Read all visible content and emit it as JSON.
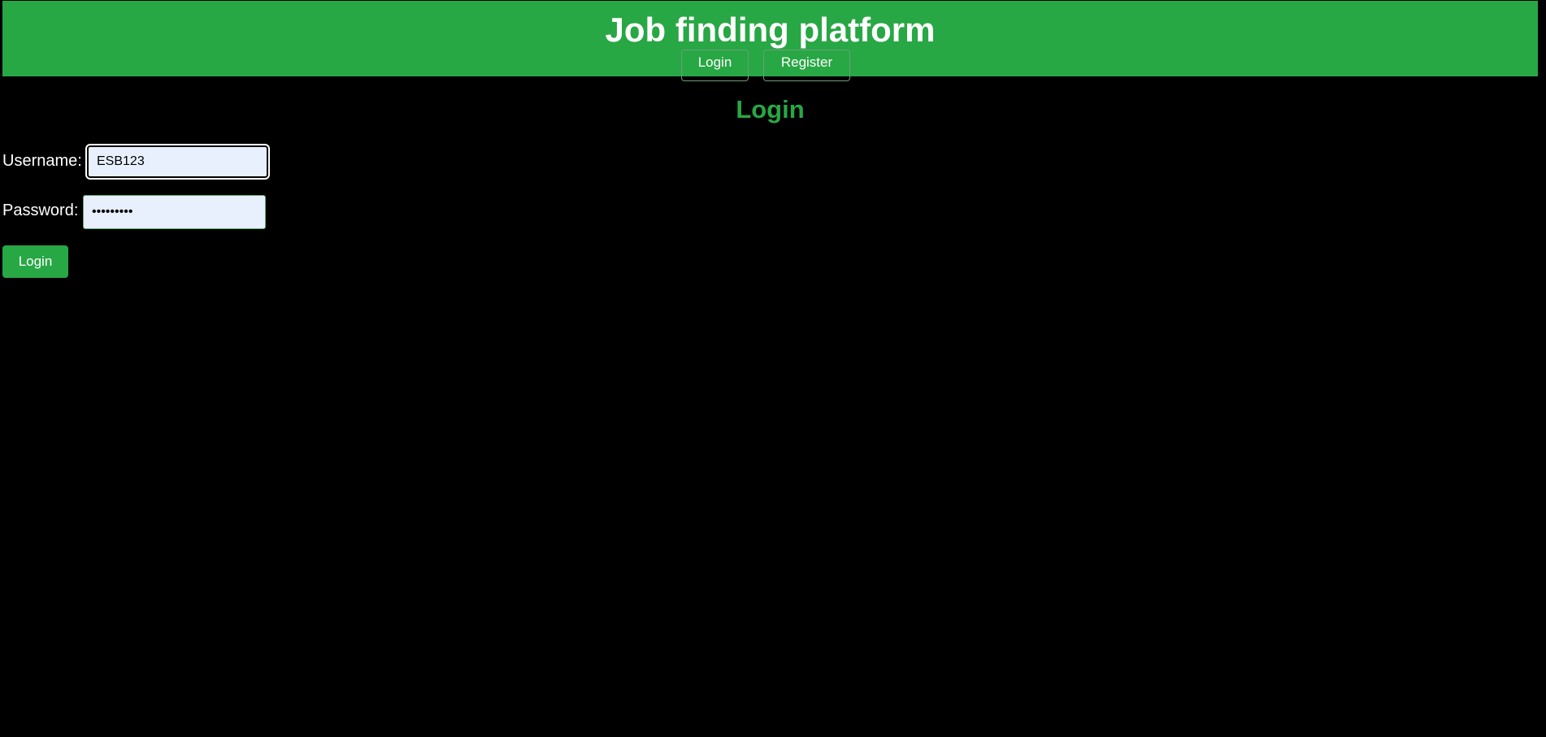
{
  "header": {
    "title": "Job finding platform",
    "nav": {
      "login_label": "Login",
      "register_label": "Register"
    }
  },
  "login_form": {
    "title": "Login",
    "username": {
      "label": "Username:",
      "value": "ESB123"
    },
    "password": {
      "label": "Password:",
      "value": "•••••••••"
    },
    "submit_label": "Login"
  },
  "colors": {
    "brand_green": "#28a745",
    "background": "#000000",
    "input_background": "#e8f0fe"
  }
}
